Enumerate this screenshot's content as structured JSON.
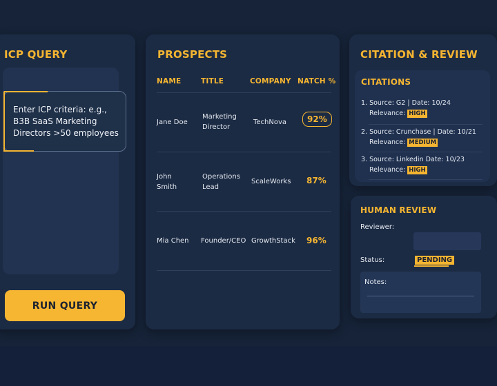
{
  "icp": {
    "title": "ICP QUERY",
    "query_text": "Enter ICP criteria: e.g., B3B SaaS Marketing Directors >50 employees",
    "run_label": "RUN QUERY"
  },
  "prospects": {
    "title": "PROSPECTS",
    "headers": [
      "NAME",
      "TITLE",
      "COMPANY",
      "NATCH %"
    ],
    "rows": [
      {
        "name": "Jane Doe",
        "title": "Marketing Director",
        "company": "TechNova",
        "match": "92%"
      },
      {
        "name": "John Smith",
        "title": "Operations Lead",
        "company": "ScaleWorks",
        "match": "87%"
      },
      {
        "name": "Mia Chen",
        "title": "Founder/CEO",
        "company": "GrowthStack",
        "match": "96%"
      }
    ]
  },
  "citation": {
    "title": "CITATION & REVIEW",
    "subtitle": "CITATIONS",
    "items": [
      {
        "text": "1. Source: G2 | Date: 10/24",
        "relevance_label": "Relevance:",
        "relevance": "HIGH"
      },
      {
        "text": "2. Source: Crunchase | Date: 10/21",
        "relevance_label": "Relevance:",
        "relevance": "MEDIUM"
      },
      {
        "text": "3. Source: Linkedin  Date: 10/23",
        "relevance_label": "Relevance:",
        "relevance": "HIGH"
      }
    ]
  },
  "review": {
    "title": "HUMAN REVIEW",
    "reviewer_label": "Reviewer:",
    "status_label": "Status:",
    "status": "PENDING",
    "notes_label": "Notes:"
  },
  "colors": {
    "accent": "#f5b531",
    "background": "#162338",
    "panel": "#1c2b44"
  }
}
